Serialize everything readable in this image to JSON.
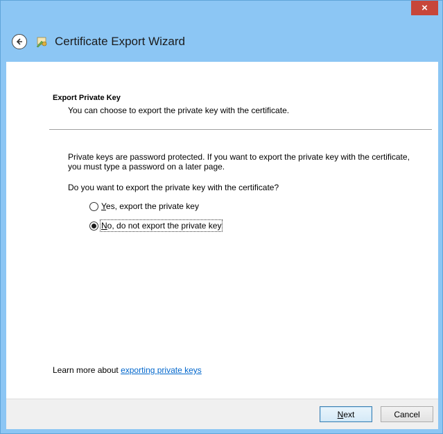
{
  "window": {
    "close_glyph": "×",
    "title": "Certificate Export Wizard"
  },
  "section": {
    "title": "Export Private Key",
    "subtitle": "You can choose to export the private key with the certificate."
  },
  "body": {
    "paragraph": "Private keys are password protected. If you want to export the private key with the certificate, you must type a password on a later page.",
    "question": "Do you want to export the private key with the certificate?"
  },
  "options": [
    {
      "mnemonic": "Y",
      "rest": "es, export the private key",
      "selected": false
    },
    {
      "mnemonic": "N",
      "rest": "o, do not export the private key",
      "selected": true
    }
  ],
  "learn_more": {
    "prefix": "Learn more about ",
    "link": "exporting private keys"
  },
  "buttons": {
    "next_mnemonic": "N",
    "next_rest": "ext",
    "cancel": "Cancel"
  },
  "colors": {
    "title_bar": "#8cc6f4",
    "close_button": "#c7463a",
    "link": "#0066cc"
  },
  "icons": {
    "back": "back-arrow-icon",
    "wizard": "certificate-wizard-icon",
    "close": "close-icon"
  }
}
